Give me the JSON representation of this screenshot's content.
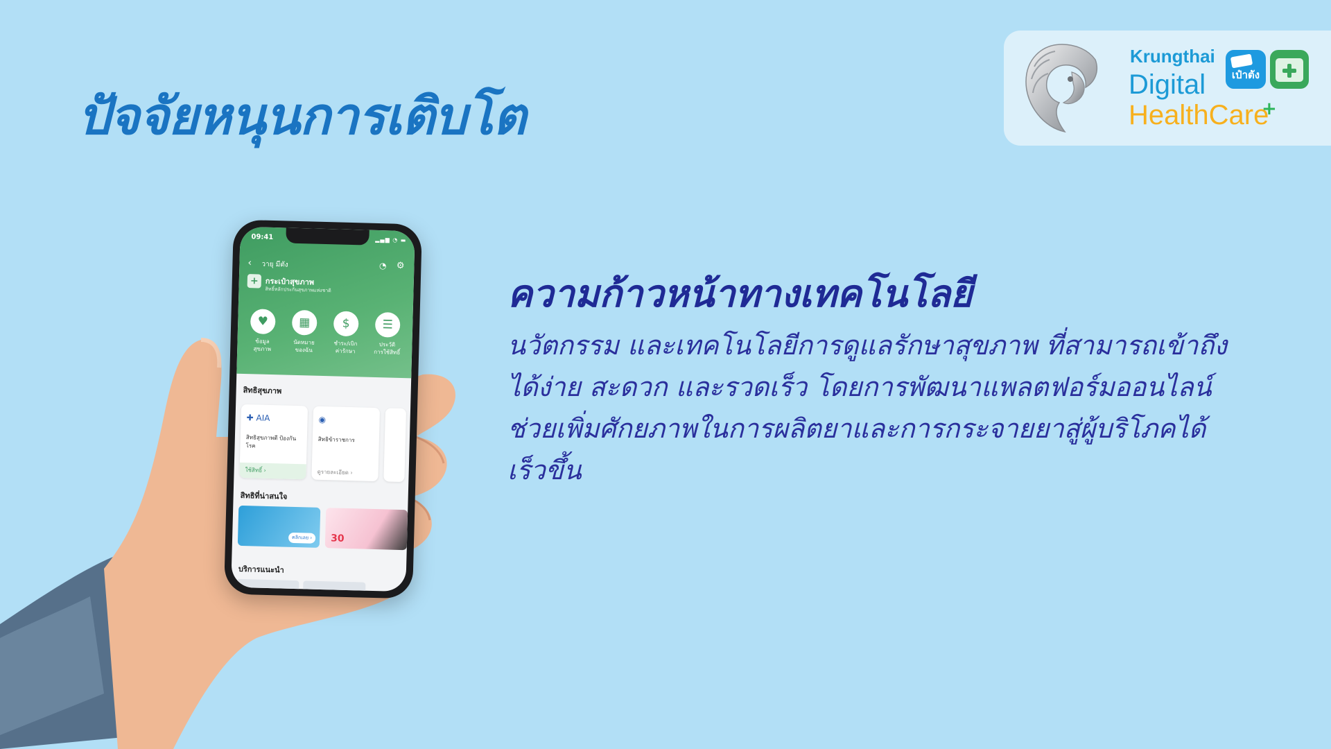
{
  "slide": {
    "title": "ปัจจัยหนุนการเติบโต",
    "subheading": "ความก้าวหน้าทางเทคโนโลยี",
    "body_lines": [
      "นวัตกรรม และเทคโนโลยีการดูแลรักษาสุขภาพ ที่สามารถเข้าถึง",
      "ได้ง่าย สะดวก และรวดเร็ว โดยการพัฒนาแพลตฟอร์มออนไลน์",
      "ช่วยเพิ่มศักยภาพในการผลิตยาและการกระจายยาสู่ผู้บริโภคได้",
      "เร็วขึ้น"
    ]
  },
  "logo": {
    "line1": "Krungthai",
    "line2": "Digital",
    "line3": "HealthCare",
    "plus": "+",
    "paotang_label": "เป๋าตัง",
    "garuda_icon": "garuda-emblem-icon",
    "colors": {
      "blue": "#1c9ad6",
      "orange": "#f7b01d",
      "green": "#2cb559"
    }
  },
  "phone": {
    "status_time": "09:41",
    "status_icons": "▂▄▆ ◔ ▬",
    "nav_title": "วายุ มีตัง",
    "wallet_title": "กระเป๋าสุขภาพ",
    "wallet_subtitle": "สิทธิ์หลักประกันสุขภาพแห่งชาติ",
    "quick_actions": [
      {
        "icon": "♥",
        "label_1": "ข้อมูล",
        "label_2": "สุขภาพ"
      },
      {
        "icon": "▦",
        "label_1": "นัดหมาย",
        "label_2": "ของฉัน"
      },
      {
        "icon": "$",
        "label_1": "ชำระ/เบิก",
        "label_2": "ค่ารักษา"
      },
      {
        "icon": "☰",
        "label_1": "ประวัติ",
        "label_2": "การใช้สิทธิ์"
      }
    ],
    "section_benefits": "สิทธิสุขภาพ",
    "benefit_cards": [
      {
        "logos": "✚ AIA",
        "label": "สิทธิสุขภาพดี ป้องกันโรค",
        "footer": "ใช้สิทธิ์ ›"
      },
      {
        "logos": "◉",
        "label": "สิทธิข้าราชการ",
        "footer": "ดูรายละเอียด ›"
      }
    ],
    "section_interesting": "สิทธิที่น่าสนใจ",
    "promo_badge": "คลิกเลย ›",
    "promo_price": "30",
    "section_services": "บริการแนะนำ",
    "accent": "#3f9c61"
  }
}
